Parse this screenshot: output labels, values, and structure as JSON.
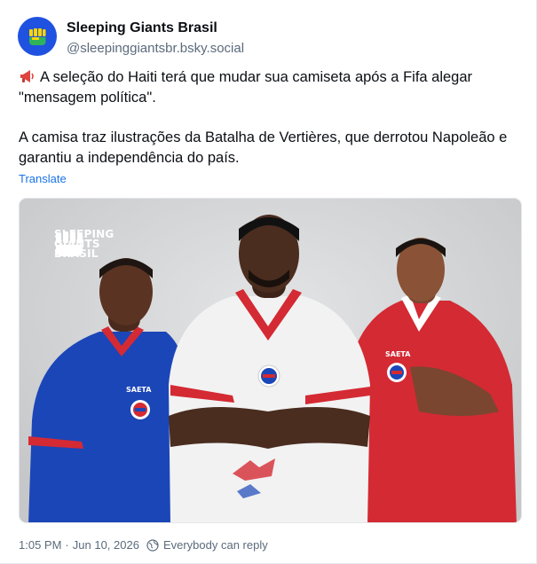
{
  "author": {
    "name": "Sleeping Giants Brasil",
    "handle": "@sleepinggiantsbr.bsky.social",
    "avatar_icon": "raised-fist-icon",
    "avatar_color": "#1f52e0"
  },
  "post": {
    "emoji": "megaphone-icon",
    "paragraph1": "A seleção do Haiti terá que mudar sua camiseta após a Fifa alegar \"mensagem política\".",
    "paragraph2": "A camisa traz ilustrações da Batalha de Vertières, que derrotou Napoleão e garantiu a independência do país.",
    "translate_label": "Translate"
  },
  "image": {
    "watermark": [
      "SLEEPING",
      "GIANTS",
      "BRASIL"
    ],
    "jersey_brand": "SAETA"
  },
  "footer": {
    "time": "1:05 PM",
    "date": "Jun 10, 2026",
    "separator": "·",
    "reply_setting": "Everybody can reply"
  },
  "colors": {
    "link": "#1a73e8",
    "muted": "#5b6b7c",
    "blue_jersey": "#1b46b8",
    "red_jersey": "#d42a33",
    "white_jersey": "#f2f2f2"
  }
}
